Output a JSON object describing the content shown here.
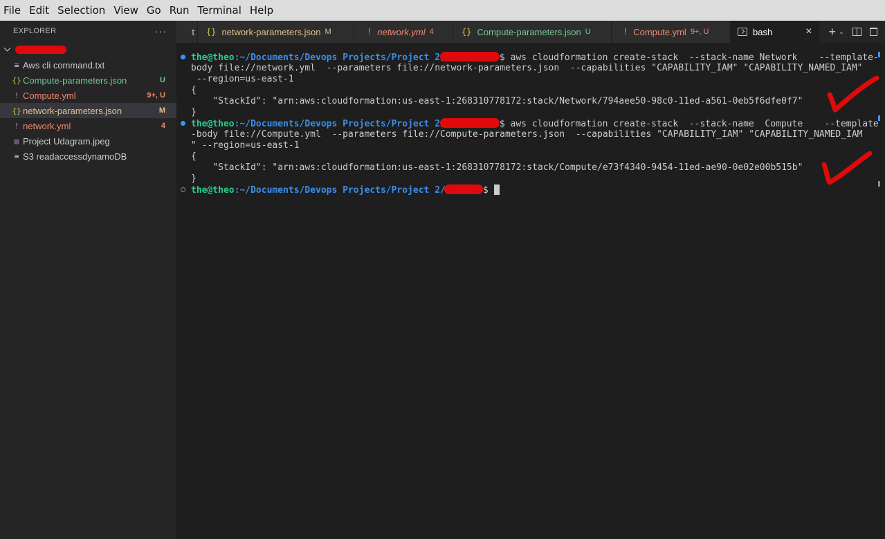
{
  "menu": [
    "File",
    "Edit",
    "Selection",
    "View",
    "Go",
    "Run",
    "Terminal",
    "Help"
  ],
  "sidebar": {
    "header": "EXPLORER",
    "more": "···",
    "files": [
      {
        "icon": "≡",
        "name": "Aws cli command.txt",
        "badge": "",
        "color": "white"
      },
      {
        "icon": "{}",
        "name": "Compute-parameters.json",
        "badge": "U",
        "color": "green"
      },
      {
        "icon": "!",
        "name": "Compute.yml",
        "badge": "9+, U",
        "color": "red"
      },
      {
        "icon": "{}",
        "name": "network-parameters.json",
        "badge": "M",
        "color": "orange"
      },
      {
        "icon": "!",
        "name": "network.yml",
        "badge": "4",
        "color": "red"
      },
      {
        "icon": "▨",
        "name": "Project Udagram.jpeg",
        "badge": "",
        "color": "white"
      },
      {
        "icon": "≡",
        "name": "S3 readaccessdynamoDB",
        "badge": "",
        "color": "white"
      }
    ]
  },
  "tabs": [
    {
      "icon": "",
      "label": "t",
      "badge": ""
    },
    {
      "icon": "{}",
      "label": "network-parameters.json",
      "badge": "M"
    },
    {
      "icon": "!",
      "label": "network.yml",
      "badge": "4"
    },
    {
      "icon": "{}",
      "label": "Compute-parameters.json",
      "badge": "U"
    },
    {
      "icon": "!",
      "label": "Compute.yml",
      "badge": "9+, U"
    }
  ],
  "terminal_tab": {
    "label": "bash",
    "close": "×",
    "add": "+",
    "caret": "⌄"
  },
  "terminal": {
    "user": "the@theo",
    "path": ":~/Documents/Devops Projects/Project 2/",
    "prompt_end": "$ ",
    "block1": {
      "cmd1": "aws cloudformation create-stack  --stack-name Network    --template-",
      "cmd2": "body file://network.yml  --parameters file://network-parameters.json  --capabilities \"CAPABILITY_IAM\" \"CAPABILITY_NAMED_IAM\"",
      "cmd3": " --region=us-east-1",
      "open": "{",
      "stackid": "    \"StackId\": \"arn:aws:cloudformation:us-east-1:268310778172:stack/Network/794aee50-98c0-11ed-a561-0eb5f6dfe0f7\"",
      "close": "}"
    },
    "block2": {
      "cmd1": "aws cloudformation create-stack  --stack-name  Compute    --template",
      "cmd2": "-body file://Compute.yml  --parameters file://Compute-parameters.json  --capabilities \"CAPABILITY_IAM\" \"CAPABILITY_NAMED_IAM",
      "cmd3": "\" --region=us-east-1",
      "open": "{",
      "stackid": "    \"StackId\": \"arn:aws:cloudformation:us-east-1:268310778172:stack/Compute/e73f4340-9454-11ed-ae90-0e02e00b515b\"",
      "close": "}"
    }
  },
  "colors": {
    "redaction": "#e00a0a",
    "prompt_user": "#23d18b",
    "prompt_path": "#3b8eea"
  }
}
